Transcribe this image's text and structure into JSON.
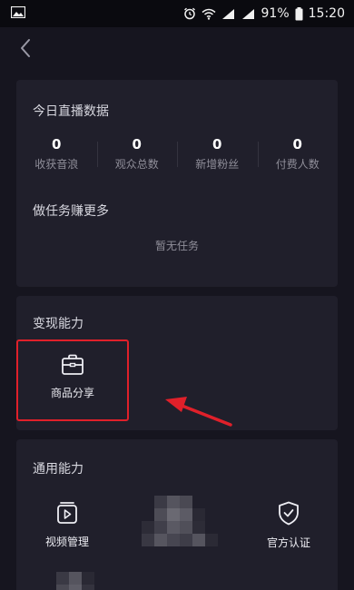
{
  "status_bar": {
    "battery": "91%",
    "time": "15:20"
  },
  "nav": {
    "back_icon": "chevron-left-icon"
  },
  "live_data": {
    "title": "今日直播数据",
    "stats": [
      {
        "value": "0",
        "label": "收获音浪"
      },
      {
        "value": "0",
        "label": "观众总数"
      },
      {
        "value": "0",
        "label": "新增粉丝"
      },
      {
        "value": "0",
        "label": "付费人数"
      }
    ]
  },
  "tasks": {
    "title": "做任务赚更多",
    "empty_text": "暂无任务"
  },
  "monetize": {
    "title": "变现能力",
    "items": [
      {
        "label": "商品分享",
        "icon": "briefcase-icon"
      }
    ]
  },
  "general": {
    "title": "通用能力",
    "items": [
      {
        "label": "视频管理",
        "icon": "video-manage-icon"
      },
      {
        "label": "官方认证",
        "icon": "shield-check-icon"
      }
    ]
  },
  "colors": {
    "background": "#16151f",
    "card": "#201f2b",
    "highlight": "#e0202a",
    "arrow": "#e0202a"
  }
}
